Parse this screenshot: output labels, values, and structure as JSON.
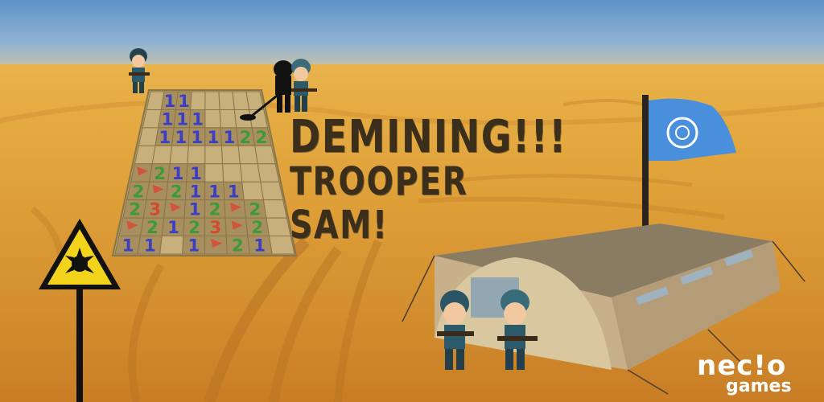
{
  "game": {
    "title_line1": "DEMINING!!!",
    "title_line2": "TROOPER SAM!",
    "publisher_logo_top": "nec!o",
    "publisher_logo_bottom": "games"
  },
  "minefield": {
    "rows": [
      [
        "",
        "1",
        "1",
        "",
        "",
        "",
        "",
        ""
      ],
      [
        "",
        "1",
        "1",
        "1",
        "",
        "",
        "",
        ""
      ],
      [
        "",
        "1",
        "1",
        "1",
        "1",
        "1",
        "2",
        "2"
      ],
      [
        "",
        "",
        "",
        "",
        "",
        "",
        "",
        ""
      ],
      [
        "flag",
        "2",
        "1",
        "1",
        "",
        "",
        "",
        ""
      ],
      [
        "2",
        "flag",
        "2",
        "1",
        "1",
        "1",
        "",
        ""
      ],
      [
        "2",
        "3",
        "flag",
        "1",
        "2",
        "flag",
        "2",
        ""
      ],
      [
        "flag",
        "2",
        "1",
        "2",
        "3",
        "flag",
        "2",
        ""
      ],
      [
        "1",
        "1",
        "",
        "1",
        "flag",
        "2",
        "1",
        ""
      ]
    ],
    "number_colors": {
      "1": "#3a3fc4",
      "2": "#3e9a38",
      "3": "#d24a2c"
    }
  },
  "colors": {
    "sky_top": "#5e93c8",
    "sand": "#e0a23a",
    "title": "#3b2e1a",
    "warning_yellow": "#f2d31b",
    "un_flag": "#4a8fdc",
    "soldier_uniform": "#2d5a6a"
  },
  "icons": [
    "explosive-warning-sign",
    "un-flag",
    "army-tent",
    "soldier",
    "metal-detector"
  ]
}
